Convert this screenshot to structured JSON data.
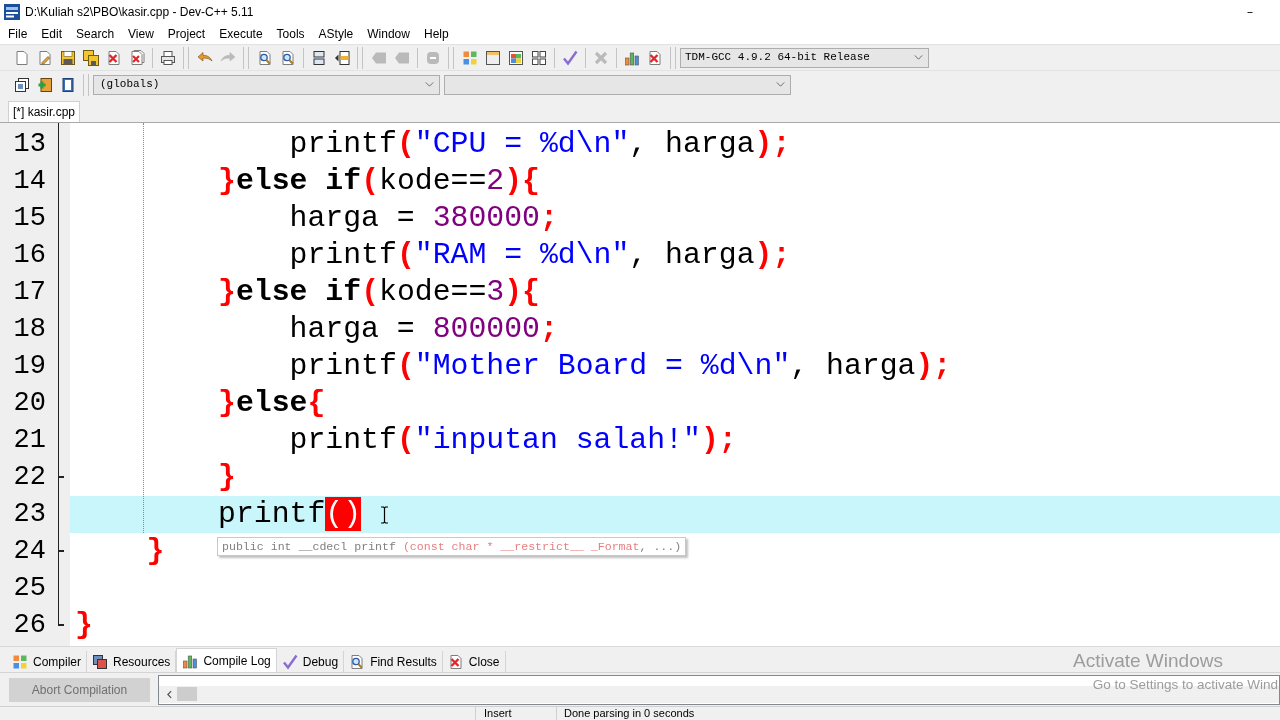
{
  "window": {
    "title": "D:\\Kuliah s2\\PBO\\kasir.cpp - Dev-C++ 5.11"
  },
  "menu": [
    "File",
    "Edit",
    "Search",
    "View",
    "Project",
    "Execute",
    "Tools",
    "AStyle",
    "Window",
    "Help"
  ],
  "main_toolbar": {
    "bands": [
      {
        "groups": [
          {
            "items": [
              {
                "kind": "new",
                "disabled": false
              },
              {
                "kind": "open",
                "disabled": false
              },
              {
                "kind": "save",
                "disabled": false
              },
              {
                "kind": "save_all",
                "disabled": false
              },
              {
                "kind": "close",
                "disabled": false
              },
              {
                "kind": "close_all",
                "disabled": false
              }
            ]
          },
          {
            "items": [
              {
                "kind": "print",
                "disabled": false
              }
            ]
          }
        ]
      },
      {
        "groups": [
          {
            "items": [
              {
                "kind": "undo",
                "disabled": false
              },
              {
                "kind": "redo",
                "disabled": true
              }
            ]
          }
        ]
      },
      {
        "groups": [
          {
            "items": [
              {
                "kind": "find",
                "disabled": false
              },
              {
                "kind": "replace",
                "disabled": false
              }
            ]
          },
          {
            "items": [
              {
                "kind": "indent",
                "disabled": false
              },
              {
                "kind": "unindent",
                "disabled": false
              }
            ]
          }
        ]
      },
      {
        "groups": [
          {
            "items": [
              {
                "kind": "goto_prev",
                "disabled": true
              },
              {
                "kind": "goto_next",
                "disabled": true
              }
            ]
          },
          {
            "items": [
              {
                "kind": "toggle",
                "disabled": true
              }
            ]
          }
        ]
      },
      {
        "groups": [
          {
            "items": [
              {
                "kind": "compile",
                "disabled": false
              },
              {
                "kind": "run",
                "disabled": false
              },
              {
                "kind": "compile_run",
                "disabled": false
              },
              {
                "kind": "rebuild",
                "disabled": false
              }
            ]
          },
          {
            "items": [
              {
                "kind": "syntax_check",
                "disabled": false
              }
            ]
          },
          {
            "items": [
              {
                "kind": "stop",
                "disabled": true
              }
            ]
          },
          {
            "items": [
              {
                "kind": "profile",
                "disabled": false
              },
              {
                "kind": "delete_profile",
                "disabled": false
              }
            ]
          }
        ]
      }
    ],
    "compiler": {
      "value": "TDM-GCC 4.9.2 64-bit Release"
    }
  },
  "class_toolbar": {
    "items": [
      {
        "kind": "new_class",
        "disabled": false
      },
      {
        "kind": "add_file",
        "disabled": false
      },
      {
        "kind": "remove_file",
        "disabled": false
      }
    ],
    "scope": {
      "value": "(globals)"
    }
  },
  "editor_tabs": [
    {
      "label": "[*] kasir.cpp",
      "selected": true
    }
  ],
  "editor": {
    "lines": [
      {
        "number": "13",
        "current": false,
        "fold_end": false,
        "tokens": [
          {
            "kind": "text",
            "text": "            printf"
          },
          {
            "kind": "symbol",
            "text": "("
          },
          {
            "kind": "string",
            "text": "\"CPU = %d\\n\""
          },
          {
            "kind": "text",
            "text": ", harga"
          },
          {
            "kind": "symbol",
            "text": ");"
          }
        ]
      },
      {
        "number": "14",
        "current": false,
        "fold_end": false,
        "tokens": [
          {
            "kind": "symbol",
            "text": "        }"
          },
          {
            "kind": "keyword",
            "text": "else if"
          },
          {
            "kind": "symbol",
            "text": "("
          },
          {
            "kind": "text",
            "text": "kode=="
          },
          {
            "kind": "number",
            "text": "2"
          },
          {
            "kind": "symbol",
            "text": "){"
          }
        ]
      },
      {
        "number": "15",
        "current": false,
        "fold_end": false,
        "tokens": [
          {
            "kind": "text",
            "text": "            harga = "
          },
          {
            "kind": "number",
            "text": "380000"
          },
          {
            "kind": "symbol",
            "text": ";"
          }
        ]
      },
      {
        "number": "16",
        "current": false,
        "fold_end": false,
        "tokens": [
          {
            "kind": "text",
            "text": "            printf"
          },
          {
            "kind": "symbol",
            "text": "("
          },
          {
            "kind": "string",
            "text": "\"RAM = %d\\n\""
          },
          {
            "kind": "text",
            "text": ", harga"
          },
          {
            "kind": "symbol",
            "text": ");"
          }
        ]
      },
      {
        "number": "17",
        "current": false,
        "fold_end": false,
        "tokens": [
          {
            "kind": "symbol",
            "text": "        }"
          },
          {
            "kind": "keyword",
            "text": "else if"
          },
          {
            "kind": "symbol",
            "text": "("
          },
          {
            "kind": "text",
            "text": "kode=="
          },
          {
            "kind": "number",
            "text": "3"
          },
          {
            "kind": "symbol",
            "text": "){"
          }
        ]
      },
      {
        "number": "18",
        "current": false,
        "fold_end": false,
        "tokens": [
          {
            "kind": "text",
            "text": "            harga = "
          },
          {
            "kind": "number",
            "text": "800000"
          },
          {
            "kind": "symbol",
            "text": ";"
          }
        ]
      },
      {
        "number": "19",
        "current": false,
        "fold_end": false,
        "tokens": [
          {
            "kind": "text",
            "text": "            printf"
          },
          {
            "kind": "symbol",
            "text": "("
          },
          {
            "kind": "string",
            "text": "\"Mother Board = %d\\n\""
          },
          {
            "kind": "text",
            "text": ", harga"
          },
          {
            "kind": "symbol",
            "text": ");"
          }
        ]
      },
      {
        "number": "20",
        "current": false,
        "fold_end": false,
        "tokens": [
          {
            "kind": "symbol",
            "text": "        }"
          },
          {
            "kind": "keyword",
            "text": "else"
          },
          {
            "kind": "symbol",
            "text": "{"
          }
        ]
      },
      {
        "number": "21",
        "current": false,
        "fold_end": false,
        "tokens": [
          {
            "kind": "text",
            "text": "            printf"
          },
          {
            "kind": "symbol",
            "text": "("
          },
          {
            "kind": "string",
            "text": "\"inputan salah!\""
          },
          {
            "kind": "symbol",
            "text": ");"
          }
        ]
      },
      {
        "number": "22",
        "current": false,
        "fold_end": true,
        "tokens": [
          {
            "kind": "symbol",
            "text": "        }"
          }
        ]
      },
      {
        "number": "23",
        "current": true,
        "fold_end": false,
        "tokens": [
          {
            "kind": "text",
            "text": "        printf"
          },
          {
            "kind": "match",
            "text": "()"
          }
        ]
      },
      {
        "number": "24",
        "current": false,
        "fold_end": true,
        "tokens": [
          {
            "kind": "symbol",
            "text": "    }"
          }
        ]
      },
      {
        "number": "25",
        "current": false,
        "fold_end": false
      },
      {
        "number": "26",
        "current": false,
        "fold_end": true,
        "tokens": [
          {
            "kind": "symbol",
            "text": "}"
          }
        ]
      }
    ],
    "tooltip": {
      "parts": [
        {
          "kind": "signature",
          "text": "public int __cdecl printf "
        },
        {
          "kind": "parameter",
          "text": "(const char * __restrict__ _Format"
        },
        {
          "kind": "signature",
          "text": ", ...)"
        }
      ]
    }
  },
  "bottom_tabs": [
    {
      "label": "Compiler",
      "kind": "compiler",
      "selected": false
    },
    {
      "label": "Resources",
      "kind": "resources",
      "selected": false
    },
    {
      "label": "Compile Log",
      "kind": "compile_log",
      "selected": true
    },
    {
      "label": "Debug",
      "kind": "debug",
      "selected": false
    },
    {
      "label": "Find Results",
      "kind": "find_results",
      "selected": false
    },
    {
      "label": "Close",
      "kind": "close",
      "selected": false
    }
  ],
  "compile_panel": {
    "abort_button": {
      "label": "Abort Compilation",
      "disabled": true
    }
  },
  "status_bar": {
    "mode": "Insert",
    "message": "Done parsing in 0 seconds"
  },
  "os_notice": {
    "title": "Activate Windows",
    "subtitle": "Go to Settings to activate Wind"
  }
}
